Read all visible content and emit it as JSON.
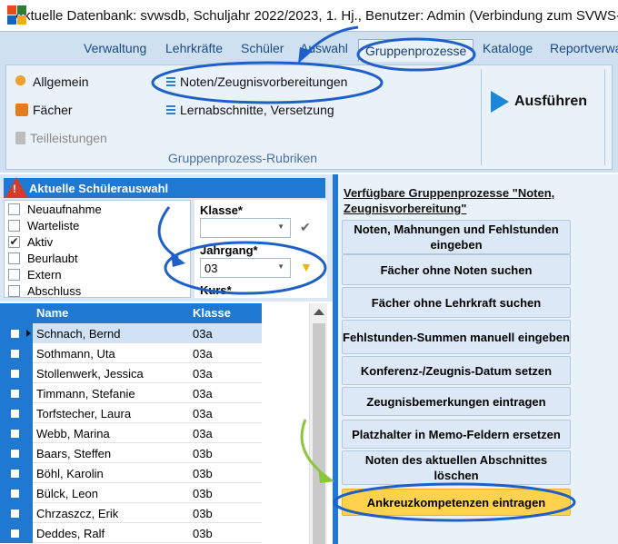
{
  "window": {
    "title": "Aktuelle Datenbank: svwsdb, Schuljahr 2022/2023, 1. Hj., Benutzer: Admin (Verbindung zum SVWS-Server"
  },
  "ribbon": {
    "tabs": [
      {
        "label": "Verwaltung"
      },
      {
        "label": "Lehrkräfte"
      },
      {
        "label": "Schüler"
      },
      {
        "label": "Auswahl"
      },
      {
        "label": "Gruppenprozesse"
      },
      {
        "label": "Kataloge"
      },
      {
        "label": "Reportverwa"
      }
    ],
    "active_tab": "Gruppenprozesse",
    "items": {
      "allgemein": "Allgemein",
      "faecher": "Fächer",
      "teilleistungen": "Teilleistungen",
      "noten": "Noten/Zeugnisvorbereitungen",
      "lernabschnitte": "Lernabschnitte, Versetzung"
    },
    "group_caption": "Gruppenprozess-Rubriken",
    "run_label": "Ausführen"
  },
  "filter": {
    "title": "Aktuelle Schülerauswahl",
    "status_items": [
      {
        "label": "Neuaufnahme",
        "checked": false
      },
      {
        "label": "Warteliste",
        "checked": false
      },
      {
        "label": "Aktiv",
        "checked": true
      },
      {
        "label": "Beurlaubt",
        "checked": false
      },
      {
        "label": "Extern",
        "checked": false
      },
      {
        "label": "Abschluss",
        "checked": false
      }
    ],
    "klasse_label": "Klasse*",
    "klasse_value": "",
    "jahrgang_label": "Jahrgang*",
    "jahrgang_value": "03",
    "kurs_label": "Kurs*"
  },
  "grid": {
    "columns": [
      "Name",
      "Klasse"
    ],
    "rows": [
      {
        "name": "Schnach, Bernd",
        "klasse": "03a"
      },
      {
        "name": "Sothmann, Uta",
        "klasse": "03a"
      },
      {
        "name": "Stollenwerk, Jessica",
        "klasse": "03a"
      },
      {
        "name": "Timmann, Stefanie",
        "klasse": "03a"
      },
      {
        "name": "Torfstecher, Laura",
        "klasse": "03a"
      },
      {
        "name": "Webb, Marina",
        "klasse": "03a"
      },
      {
        "name": "Baars, Steffen",
        "klasse": "03b"
      },
      {
        "name": "Böhl, Karolin",
        "klasse": "03b"
      },
      {
        "name": "Bülck, Leon",
        "klasse": "03b"
      },
      {
        "name": "Chrzaszcz, Erik",
        "klasse": "03b"
      },
      {
        "name": "Deddes, Ralf",
        "klasse": "03b"
      }
    ]
  },
  "processes": {
    "title": "Verfügbare Gruppenprozesse \"Noten, Zeugnisvorbereitung\"",
    "buttons": [
      "Noten, Mahnungen und Fehlstunden eingeben",
      "Fächer ohne Noten suchen",
      "Fächer ohne Lehrkraft suchen",
      "Fehlstunden-Summen manuell eingeben",
      "Konferenz-/Zeugnis-Datum setzen",
      "Zeugnisbemerkungen eintragen",
      "Platzhalter in Memo-Feldern ersetzen",
      "Noten des aktuellen Abschnittes löschen",
      "Ankreuzkompetenzen eintragen"
    ]
  },
  "colors": {
    "accent_blue": "#1f78d1",
    "annotation_blue": "#1f5fc8",
    "annotation_green": "#8cc63f",
    "highlight_yellow": "#ffd24d"
  }
}
